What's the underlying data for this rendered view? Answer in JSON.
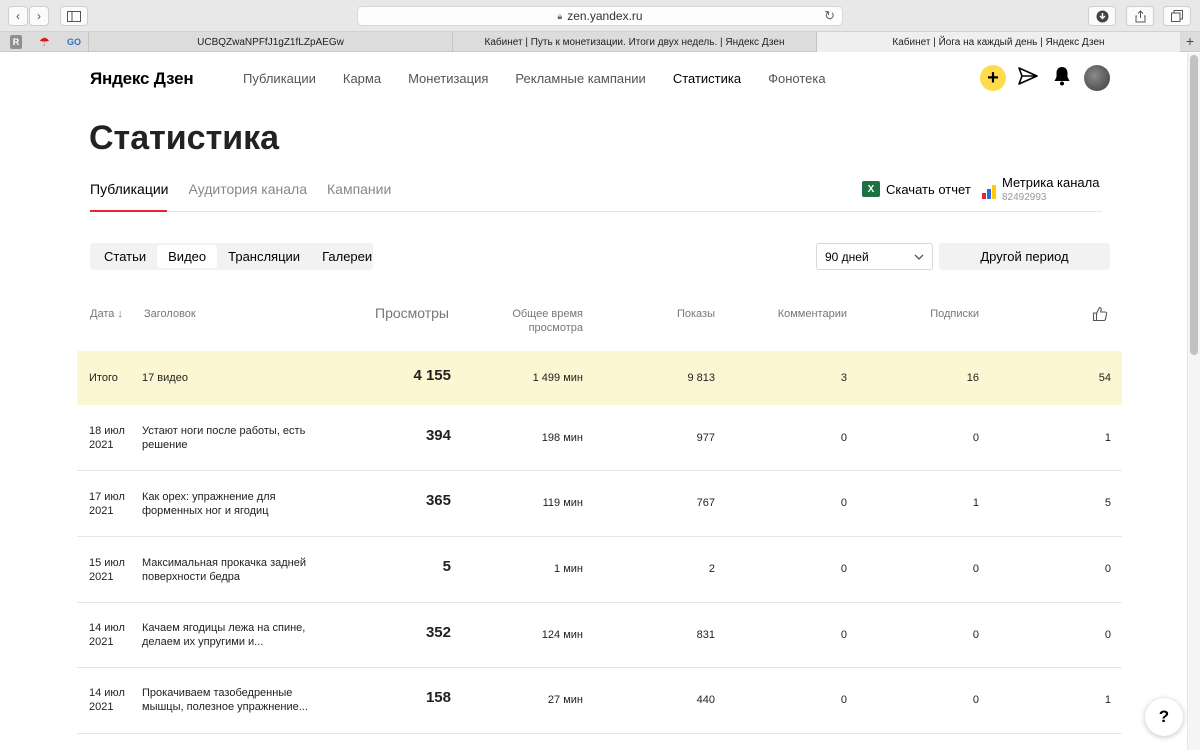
{
  "browser": {
    "url": "zen.yandex.ru",
    "tabs": [
      {
        "label": "UCBQZwaNPFfJ1gZ1fLZpAEGw",
        "active": false
      },
      {
        "label": "Кабинет | Путь к монетизации. Итоги двух недель. | Яндекс Дзен",
        "active": false
      },
      {
        "label": "Кабинет | Йога на каждый день | Яндекс Дзен",
        "active": true
      }
    ],
    "new_tab_label": "+"
  },
  "header": {
    "logo": "Яндекс Дзен",
    "nav": [
      "Публикации",
      "Карма",
      "Монетизация",
      "Рекламные кампании",
      "Статистика",
      "Фонотека"
    ],
    "active_nav": "Статистика",
    "icons": [
      "plus-icon",
      "send-icon",
      "bell-icon",
      "avatar"
    ]
  },
  "page": {
    "title": "Статистика",
    "subtabs": [
      "Публикации",
      "Аудитория канала",
      "Кампании"
    ],
    "download_label": "Скачать отчет",
    "metrika": {
      "label": "Метрика канала",
      "id": "82492993"
    },
    "content_types": [
      "Статьи",
      "Видео",
      "Трансляции",
      "Галереи"
    ],
    "active_content_type": "Видео",
    "period": "90 дней",
    "other_period": "Другой период"
  },
  "table": {
    "headers": {
      "date": "Дата",
      "title": "Заголовок",
      "views": "Просмотры",
      "time": "Общее время просмотра",
      "shows": "Показы",
      "comments": "Комментарии",
      "subs": "Подписки",
      "likes_icon": "thumbs-up-icon"
    },
    "total": {
      "label": "Итого",
      "title": "17 видео",
      "views": "4 155",
      "time": "1 499 мин",
      "shows": "9 813",
      "comments": "3",
      "subs": "16",
      "likes": "54"
    },
    "rows": [
      {
        "date1": "18 июл",
        "date2": "2021",
        "title1": "Устают ноги после работы, есть",
        "title2": "решение",
        "views": "394",
        "time": "198 мин",
        "shows": "977",
        "comments": "0",
        "subs": "0",
        "likes": "1"
      },
      {
        "date1": "17 июл",
        "date2": "2021",
        "title1": "Как орех: упражнение для",
        "title2": "форменных ног и ягодиц",
        "views": "365",
        "time": "119 мин",
        "shows": "767",
        "comments": "0",
        "subs": "1",
        "likes": "5"
      },
      {
        "date1": "15 июл",
        "date2": "2021",
        "title1": "Максимальная прокачка задней",
        "title2": "поверхности бедра",
        "views": "5",
        "time": "1 мин",
        "shows": "2",
        "comments": "0",
        "subs": "0",
        "likes": "0"
      },
      {
        "date1": "14 июл",
        "date2": "2021",
        "title1": "Качаем ягодицы лежа на спине,",
        "title2": "делаем их упругими и...",
        "views": "352",
        "time": "124 мин",
        "shows": "831",
        "comments": "0",
        "subs": "0",
        "likes": "0"
      },
      {
        "date1": "14 июл",
        "date2": "2021",
        "title1": "Прокачиваем тазобедренные",
        "title2": "мышцы, полезное упражнение...",
        "views": "158",
        "time": "27 мин",
        "shows": "440",
        "comments": "0",
        "subs": "0",
        "likes": "1"
      }
    ]
  },
  "help_label": "?"
}
